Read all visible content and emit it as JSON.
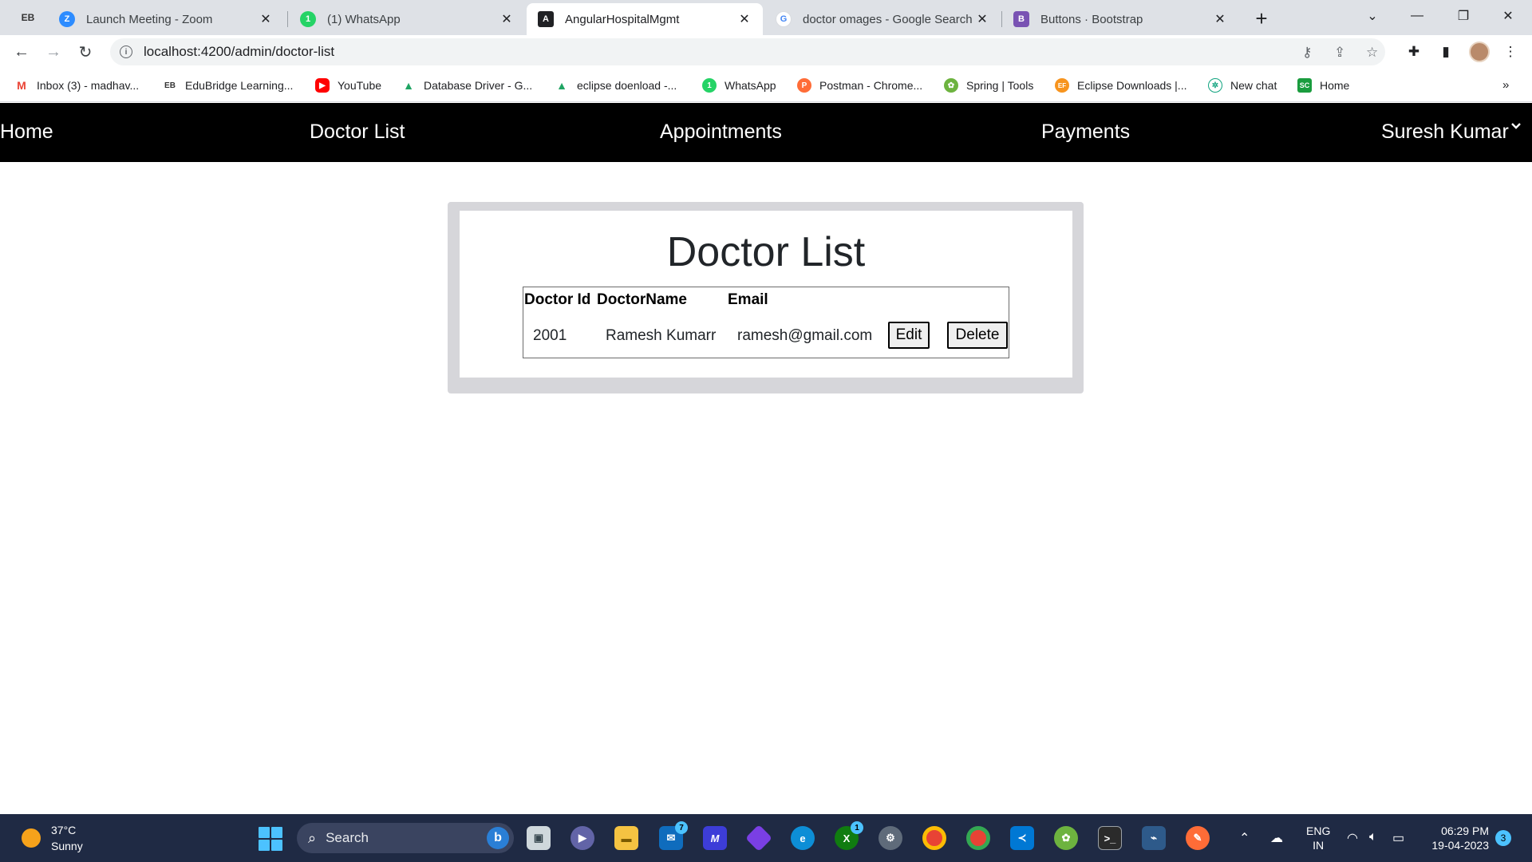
{
  "browser": {
    "profile_badge": "EB",
    "tabs": [
      {
        "title": "Launch Meeting - Zoom",
        "icon": "zoom-icon",
        "color": "#2d8cff"
      },
      {
        "title": "(1) WhatsApp",
        "icon": "whatsapp-icon",
        "color": "#25d366",
        "badge": "1"
      },
      {
        "title": "AngularHospitalMgmt",
        "icon": "angular-icon",
        "color": "#202124",
        "active": true
      },
      {
        "title": "doctor omages - Google Search",
        "icon": "google-icon",
        "color": "#4285f4"
      },
      {
        "title": "Buttons · Bootstrap",
        "icon": "bootstrap-icon",
        "color": "#7952b3"
      }
    ],
    "url": "localhost:4200/admin/doctor-list",
    "bookmarks": [
      {
        "label": "Inbox (3) - madhav...",
        "icon": "gmail-icon"
      },
      {
        "label": "EduBridge Learning...",
        "icon": "edubridge-icon"
      },
      {
        "label": "YouTube",
        "icon": "youtube-icon"
      },
      {
        "label": "Database Driver - G...",
        "icon": "google-drive-icon"
      },
      {
        "label": "eclipse doenload -...",
        "icon": "google-drive-icon"
      },
      {
        "label": "WhatsApp",
        "icon": "whatsapp-icon"
      },
      {
        "label": "Postman - Chrome...",
        "icon": "postman-icon"
      },
      {
        "label": "Spring | Tools",
        "icon": "spring-icon"
      },
      {
        "label": "Eclipse Downloads |...",
        "icon": "eclipse-icon"
      },
      {
        "label": "New chat",
        "icon": "chatgpt-icon"
      },
      {
        "label": "Home",
        "icon": "home-sc-icon"
      }
    ]
  },
  "navbar": {
    "home": "Home",
    "doctor_list": "Doctor List",
    "appointments": "Appointments",
    "payments": "Payments",
    "user": "Suresh Kumar"
  },
  "page": {
    "title": "Doctor List",
    "columns": [
      "Doctor Id",
      "DoctorName",
      "Email"
    ],
    "rows": [
      {
        "id": "2001",
        "name": "Ramesh Kumarr",
        "email": "ramesh@gmail.com",
        "edit_label": "Edit",
        "delete_label": "Delete"
      }
    ]
  },
  "taskbar": {
    "temperature": "37°C",
    "weather": "Sunny",
    "search_label": "Search",
    "language_line1": "ENG",
    "language_line2": "IN",
    "time": "06:29 PM",
    "date": "19-04-2023",
    "notification_count": "3",
    "mail_badge": "7",
    "xbox_badge": "1"
  }
}
